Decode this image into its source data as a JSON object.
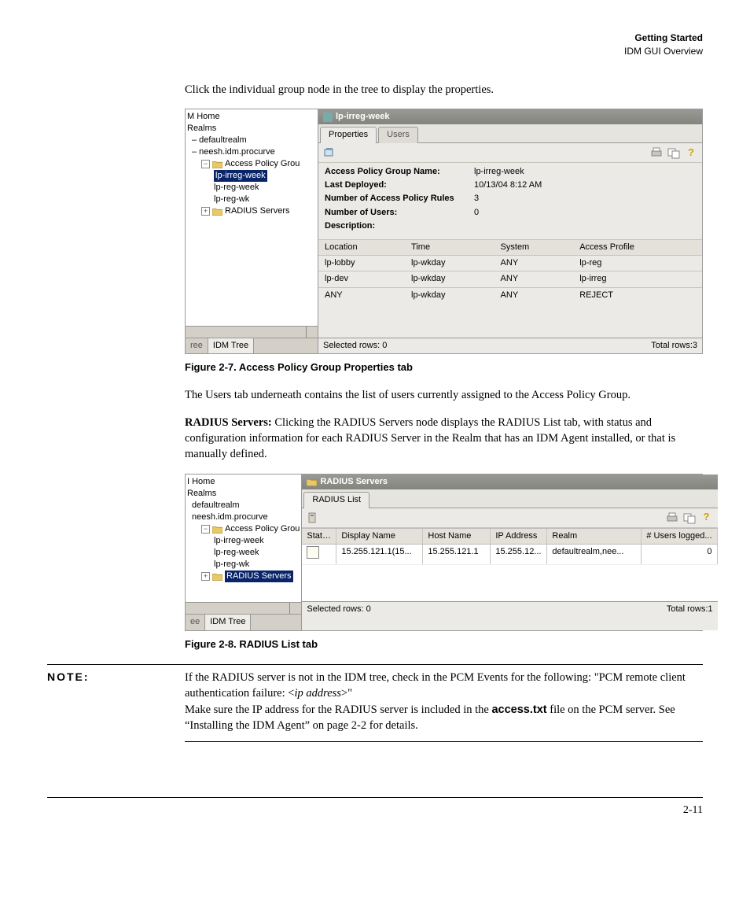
{
  "header": {
    "title": "Getting Started",
    "subtitle": "IDM GUI Overview"
  },
  "intro1": "Click the individual group node in the tree to display the properties.",
  "fig1": {
    "caption": "Figure 2-7. Access Policy Group Properties tab",
    "tree": {
      "root": "M Home",
      "realms": "Realms",
      "items": [
        "defaultrealm",
        "neesh.idm.procurve",
        "Access Policy Grou",
        "lp-irreg-week",
        "lp-reg-week",
        "lp-reg-wk",
        "RADIUS Servers"
      ],
      "tab_left": "ree",
      "tab_right": "IDM Tree"
    },
    "title": "lp-irreg-week",
    "tabs": [
      "Properties",
      "Users"
    ],
    "props": [
      {
        "lbl": "Access Policy Group Name:",
        "val": "lp-irreg-week"
      },
      {
        "lbl": "Last Deployed:",
        "val": "10/13/04 8:12 AM"
      },
      {
        "lbl": "Number of Access Policy Rules",
        "val": "3"
      },
      {
        "lbl": "Number of Users:",
        "val": "0"
      },
      {
        "lbl": "Description:",
        "val": ""
      }
    ],
    "cols": [
      "Location",
      "Time",
      "System",
      "Access Profile"
    ],
    "rows": [
      [
        "lp-lobby",
        "lp-wkday",
        "ANY",
        "lp-reg"
      ],
      [
        "lp-dev",
        "lp-wkday",
        "ANY",
        "lp-irreg"
      ],
      [
        "ANY",
        "lp-wkday",
        "ANY",
        "REJECT"
      ]
    ],
    "status_left": "Selected rows: 0",
    "status_right": "Total rows:3"
  },
  "para2": "The Users tab underneath contains the list of users currently assigned to the Access Policy Group.",
  "para3_lead": "RADIUS Servers:",
  "para3_rest": " Clicking the RADIUS Servers node displays the RADIUS List tab, with status and configuration information for each RADIUS Server in the Realm that has an IDM Agent installed, or that is manually defined.",
  "fig2": {
    "caption": "Figure 2-8. RADIUS List tab",
    "tree": {
      "root": "I Home",
      "realms": "Realms",
      "items": [
        "defaultrealm",
        "neesh.idm.procurve",
        "Access Policy Grou",
        "lp-irreg-week",
        "lp-reg-week",
        "lp-reg-wk",
        "RADIUS Servers"
      ],
      "tab_left": "ee",
      "tab_right": "IDM Tree"
    },
    "title": "RADIUS Servers",
    "tabs": [
      "RADIUS List"
    ],
    "cols": [
      "Status",
      "Display Name",
      "Host Name",
      "IP Address",
      "Realm",
      "# Users logged..."
    ],
    "row": {
      "dn": "15.255.121.1(15...",
      "hn": "15.255.121.1",
      "ip": "15.255.12...",
      "realm": "defaultrealm,nee...",
      "users": "0"
    },
    "status_left": "Selected rows: 0",
    "status_right": "Total rows:1"
  },
  "note": {
    "label": "NOTE:",
    "l1_a": "If the RADIUS server is not in the IDM tree, check in the PCM Events for the following: \"PCM remote client authentication failure: <",
    "l1_ip": "ip address",
    "l1_b": ">\"",
    "l2_a": "Make sure the IP address for the RADIUS server is included in the ",
    "l2_file": "access.txt",
    "l2_b": " file on the PCM server. See “Installing the IDM Agent” on page 2-2 for details."
  },
  "page_number": "2-11"
}
